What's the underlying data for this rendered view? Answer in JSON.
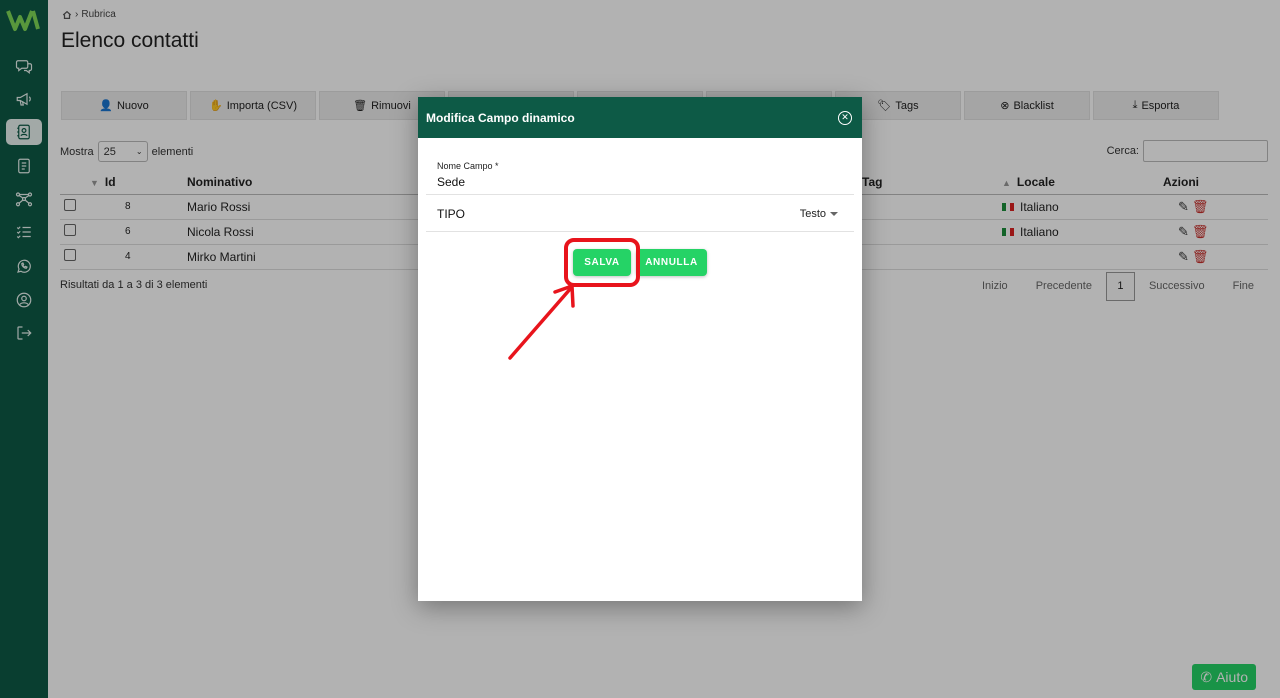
{
  "breadcrumb": {
    "section": "Rubrica"
  },
  "page": {
    "title": "Elenco contatti"
  },
  "toolbar": {
    "new_label": "Nuovo",
    "import_label": "Importa (CSV)",
    "remove_label": "Rimuovi",
    "tags_label": "Tags",
    "blacklist_label": "Blacklist",
    "export_label": "Esporta"
  },
  "listing": {
    "show_label": "Mostra",
    "page_size": "25",
    "elements_label": "elementi",
    "search_label": "Cerca:"
  },
  "table": {
    "headers": {
      "id": "Id",
      "name": "Nominativo",
      "tag": "Tag",
      "locale": "Locale",
      "actions": "Azioni"
    },
    "rows": [
      {
        "id": "8",
        "name": "Mario Rossi",
        "locale": "Italiano"
      },
      {
        "id": "6",
        "name": "Nicola Rossi",
        "locale": "Italiano"
      },
      {
        "id": "4",
        "name": "Mirko Martini",
        "locale": ""
      }
    ]
  },
  "results": {
    "text": "Risultati da 1 a 3 di 3 elementi"
  },
  "pagination": {
    "first": "Inizio",
    "prev": "Precedente",
    "current": "1",
    "next": "Successivo",
    "last": "Fine"
  },
  "help": {
    "label": "Aiuto"
  },
  "modal": {
    "title": "Modifica Campo dinamico",
    "field_label": "Nome Campo *",
    "field_value": "Sede",
    "type_label": "TIPO",
    "type_value": "Testo",
    "save_label": "SALVA",
    "cancel_label": "ANNULLA"
  },
  "colors": {
    "brand": "#0d5a46",
    "accent": "#25d366",
    "highlight": "#e8141c",
    "danger": "#c9302c"
  }
}
